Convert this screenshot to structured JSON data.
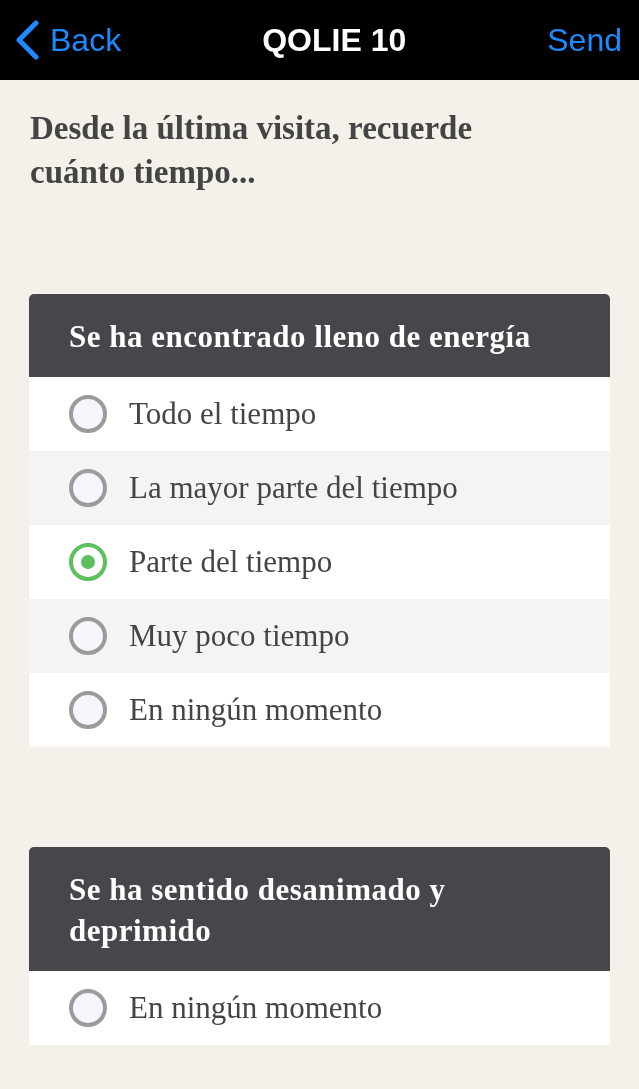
{
  "nav": {
    "back": "Back",
    "title": "QOLIE 10",
    "action": "Send"
  },
  "intro": "Desde la última visita, recuerde cuánto tiempo...",
  "questions": [
    {
      "title": "Se ha encontrado lleno de energía",
      "options": [
        {
          "label": "Todo el tiempo",
          "selected": false
        },
        {
          "label": "La mayor parte del tiempo",
          "selected": false
        },
        {
          "label": "Parte del tiempo",
          "selected": true
        },
        {
          "label": "Muy poco tiempo",
          "selected": false
        },
        {
          "label": "En ningún momento",
          "selected": false
        }
      ]
    },
    {
      "title": "Se ha sentido desanimado y deprimido",
      "options": [
        {
          "label": "En ningún momento",
          "selected": false
        }
      ]
    }
  ]
}
